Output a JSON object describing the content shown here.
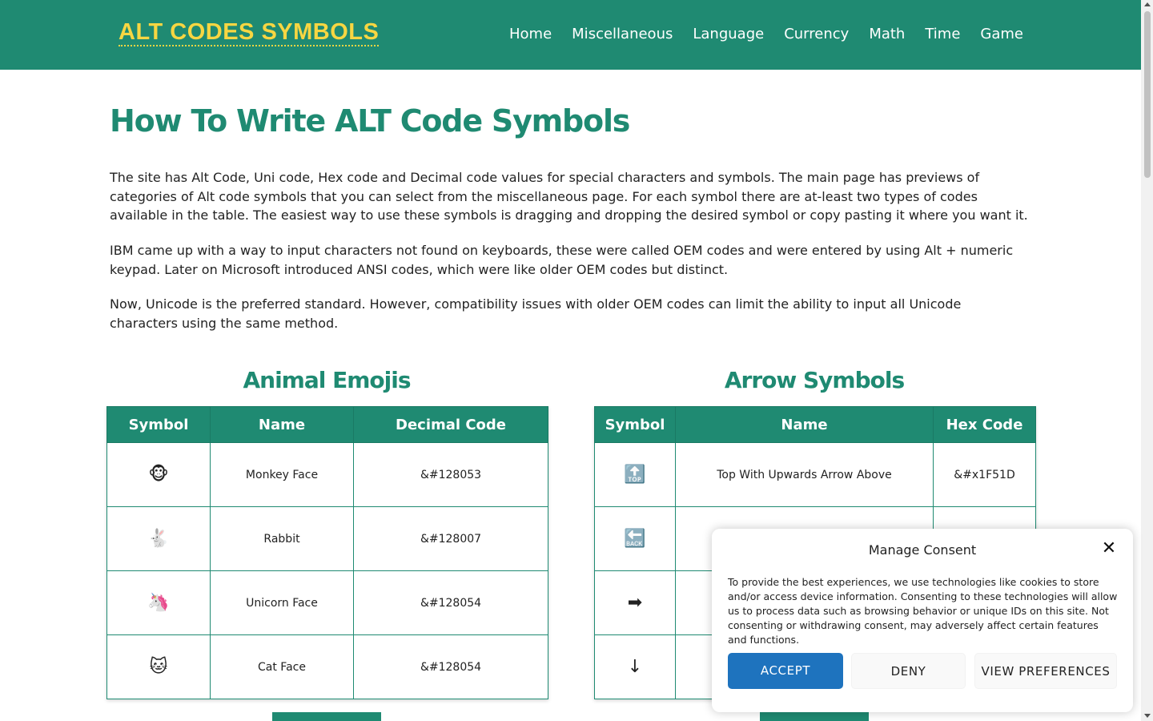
{
  "site": {
    "logo": "ALT CODES SYMBOLS",
    "nav": [
      "Home",
      "Miscellaneous",
      "Language",
      "Currency",
      "Math",
      "Time",
      "Game"
    ]
  },
  "main": {
    "title": "How To Write ALT Code Symbols",
    "paragraphs": [
      "The site has Alt Code, Uni code, Hex code and Decimal code values for special characters and symbols. The main page has previews of categories of Alt code symbols that you can select from the miscellaneous page. For each symbol there are at-least two types of codes available in the table. The easiest way to use these symbols is dragging and dropping the desired symbol or copy pasting it where you want it.",
      "IBM came up with a way to input characters not found on keyboards, these were called OEM codes and were entered by using Alt + numeric keypad. Later on Microsoft introduced ANSI codes, which were like older OEM codes but distinct.",
      "Now, Unicode is the preferred standard. However, compatibility issues with older OEM codes can limit the ability to input all Unicode characters using the same method."
    ]
  },
  "animal_table": {
    "title": "Animal Emojis",
    "headers": [
      "Symbol",
      "Name",
      "Decimal Code"
    ],
    "rows": [
      {
        "symbol": "🐵",
        "name": "Monkey Face",
        "code": "&#128053"
      },
      {
        "symbol": "🐇",
        "name": "Rabbit",
        "code": "&#128007"
      },
      {
        "symbol": "🦄",
        "name": "Unicorn Face",
        "code": "&#128054"
      },
      {
        "symbol": "🐱",
        "name": "Cat Face",
        "code": "&#128054"
      }
    ]
  },
  "arrow_table": {
    "title": "Arrow Symbols",
    "headers": [
      "Symbol",
      "Name",
      "Hex Code"
    ],
    "rows": [
      {
        "symbol": "🔝",
        "name": "Top With Upwards Arrow Above",
        "code": "&#x1F51D"
      },
      {
        "symbol": "🔙",
        "name": "",
        "code": ""
      },
      {
        "symbol": "➡",
        "name": "",
        "code": ""
      },
      {
        "symbol": "↓",
        "name": "",
        "code": ""
      }
    ]
  },
  "consent": {
    "title": "Manage Consent",
    "close": "✕",
    "text": "To provide the best experiences, we use technologies like cookies to store and/or access device information. Consenting to these technologies will allow us to process data such as browsing behavior or unique IDs on this site. Not consenting or withdrawing consent, may adversely affect certain features and functions.",
    "accept": "ACCEPT",
    "deny": "DENY",
    "preferences": "VIEW PREFERENCES"
  },
  "colors": {
    "brand": "#1f8a72",
    "logo": "#f7d642",
    "accept": "#1e73be"
  }
}
